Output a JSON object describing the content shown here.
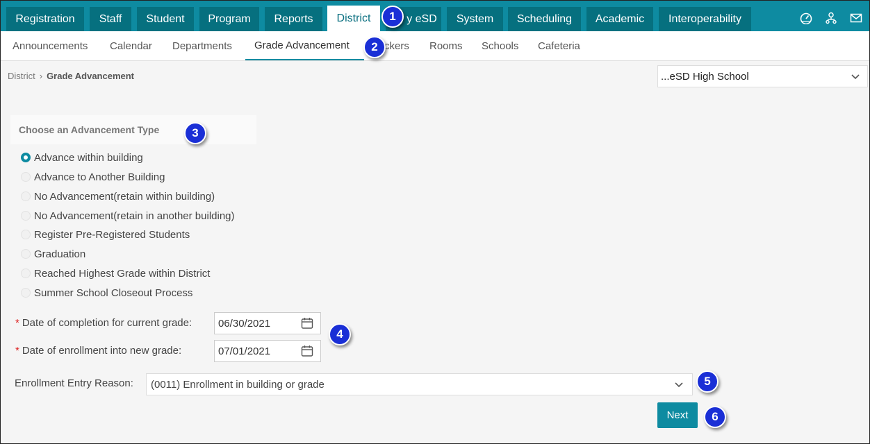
{
  "colors": {
    "accent": "#0e8ba1",
    "tab_dark": "#06707f",
    "badge": "#1a2fd6",
    "required": "#dd2222"
  },
  "top_nav": {
    "tabs": [
      "Registration",
      "Staff",
      "Student",
      "Program",
      "Reports",
      "District",
      "y eSD",
      "System",
      "Scheduling",
      "Academic",
      "Interoperability"
    ],
    "active": "District",
    "icons": [
      "dashboard-icon",
      "user-network-icon",
      "mail-icon"
    ]
  },
  "sub_nav": {
    "tabs": [
      "Announcements",
      "Calendar",
      "Departments",
      "Grade Advancement",
      "ckers",
      "Rooms",
      "Schools",
      "Cafeteria"
    ],
    "active": "Grade Advancement"
  },
  "breadcrumb": {
    "parent": "District",
    "separator": "›",
    "current": "Grade Advancement"
  },
  "school_select": {
    "value": "...eSD High School",
    "icon": "chevron-down-icon"
  },
  "advancement": {
    "title": "Choose an Advancement Type",
    "options": [
      "Advance within building",
      "Advance to Another Building",
      "No Advancement(retain within building)",
      "No Advancement(retain in another building)",
      "Register Pre-Registered Students",
      "Graduation",
      "Reached Highest Grade within District",
      "Summer School Closeout Process"
    ],
    "selected": "Advance within building"
  },
  "form": {
    "required_mark": "*",
    "completion_label": "Date of completion for current grade:",
    "completion_value": "06/30/2021",
    "enrollment_label": "Date of enrollment into new grade:",
    "enrollment_value": "07/01/2021",
    "reason_label": "Enrollment Entry Reason:",
    "reason_value": "(0011) Enrollment in building or grade"
  },
  "next_button": "Next",
  "callouts": [
    "1",
    "2",
    "3",
    "4",
    "5",
    "6"
  ]
}
